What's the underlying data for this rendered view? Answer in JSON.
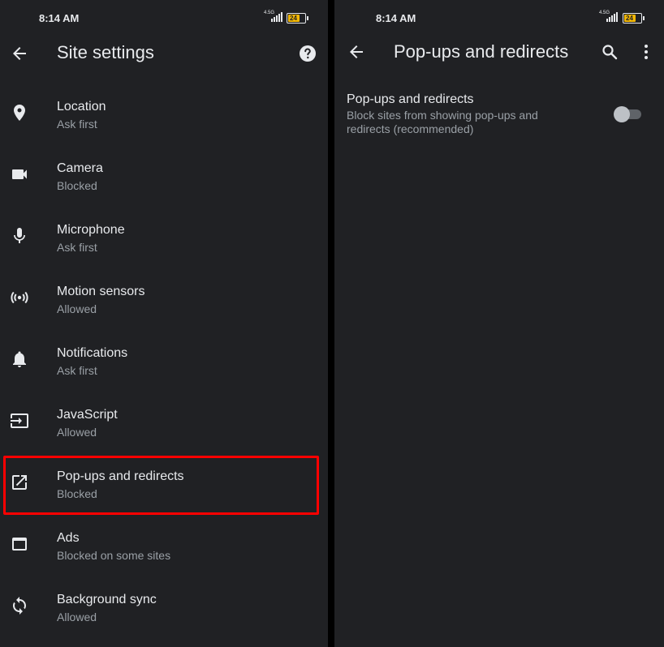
{
  "left": {
    "status": {
      "time": "8:14 AM",
      "network": "4.5G",
      "battery": "24"
    },
    "title": "Site settings",
    "items": [
      {
        "label": "Location",
        "status": "Ask first"
      },
      {
        "label": "Camera",
        "status": "Blocked"
      },
      {
        "label": "Microphone",
        "status": "Ask first"
      },
      {
        "label": "Motion sensors",
        "status": "Allowed"
      },
      {
        "label": "Notifications",
        "status": "Ask first"
      },
      {
        "label": "JavaScript",
        "status": "Allowed"
      },
      {
        "label": "Pop-ups and redirects",
        "status": "Blocked"
      },
      {
        "label": "Ads",
        "status": "Blocked on some sites"
      },
      {
        "label": "Background sync",
        "status": "Allowed"
      }
    ]
  },
  "right": {
    "status": {
      "time": "8:14 AM",
      "network": "4.5G",
      "battery": "24"
    },
    "title": "Pop-ups and redirects",
    "setting": {
      "title": "Pop-ups and redirects",
      "description": "Block sites from showing pop-ups and redirects (recommended)",
      "enabled": false
    }
  },
  "colors": {
    "background": "#202124",
    "text_primary": "#e8eaed",
    "text_secondary": "#9aa0a6",
    "highlight": "#ff0000",
    "battery": "#f2b705"
  }
}
